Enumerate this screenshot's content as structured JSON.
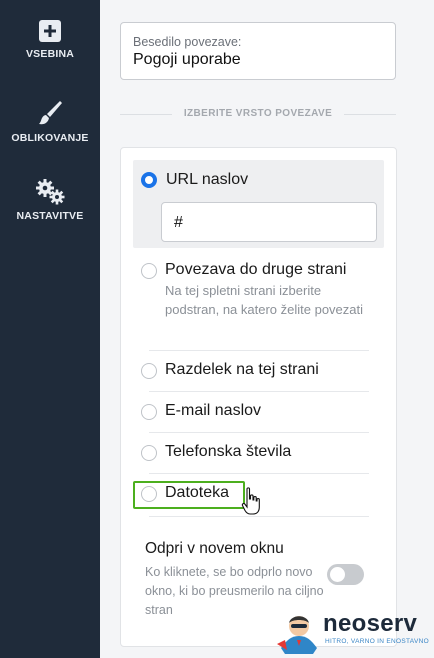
{
  "sidebar": {
    "items": [
      {
        "label": "VSEBINA",
        "icon": "plus-icon"
      },
      {
        "label": "OBLIKOVANJE",
        "icon": "brush-icon"
      },
      {
        "label": "NASTAVITVE",
        "icon": "gears-icon"
      }
    ]
  },
  "link_text": {
    "label": "Besedilo povezave:",
    "value": "Pogoji uporabe"
  },
  "link_type": {
    "heading": "IZBERITE VRSTO POVEZAVE",
    "options": [
      {
        "label": "URL naslov",
        "checked": true,
        "input_value": "#"
      },
      {
        "label": "Povezava do druge strani",
        "description": "Na tej spletni strani izberite podstran, na katero želite povezati"
      },
      {
        "label": "Razdelek na tej strani"
      },
      {
        "label": "E-mail naslov"
      },
      {
        "label": "Telefonska števila"
      },
      {
        "label": "Datoteka",
        "highlighted": true,
        "highlight_color": "#4caf1e"
      }
    ]
  },
  "new_window": {
    "title": "Odpri v novem oknu",
    "description": "Ko kliknete, se bo odprlo novo okno, ki bo preusmerilo na ciljno stran",
    "enabled": false
  },
  "brand": {
    "name": "neoserv",
    "tagline": "HITRO, VARNO IN ENOSTAVNO"
  },
  "colors": {
    "sidebar_bg": "#1f2b3a",
    "accent": "#1a73e8",
    "highlight": "#4caf1e"
  }
}
